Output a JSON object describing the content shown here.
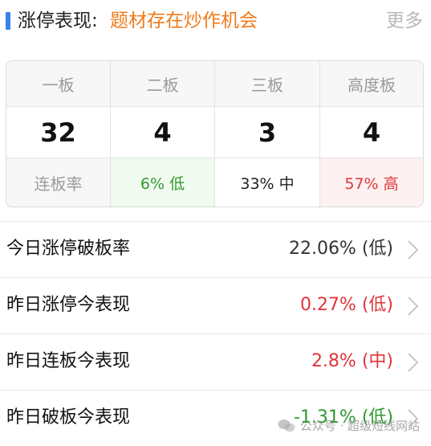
{
  "header": {
    "title": "涨停表现:",
    "topic": "题材存在炒作机会",
    "more": "更多"
  },
  "board_table": {
    "columns": [
      "一板",
      "二板",
      "三板",
      "高度板"
    ],
    "counts": [
      "32",
      "4",
      "3",
      "4"
    ],
    "rate_label": "连板率",
    "rates": [
      "6% 低",
      "33% 中",
      "57% 高"
    ],
    "colors": {
      "green": "#2f9a2f",
      "red": "#e0353a",
      "neutral": "#222222"
    }
  },
  "stats": [
    {
      "label": "今日涨停破板率",
      "value": "22.06% (低)"
    },
    {
      "label": "昨日涨停今表现",
      "value": "0.27% (低)"
    },
    {
      "label": "昨日连板今表现",
      "value": "2.8% (中)"
    },
    {
      "label": "昨日破板今表现",
      "value": "-1.31% (低)"
    }
  ],
  "watermark": {
    "icon": "wechat-icon",
    "text": "公众号 · 超级短线网站"
  }
}
